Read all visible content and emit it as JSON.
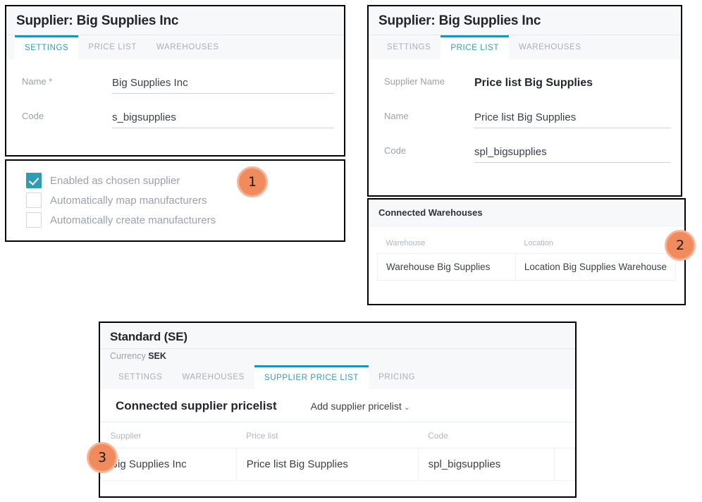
{
  "panel_supplier_settings": {
    "title": "Supplier: Big Supplies Inc",
    "tabs": [
      {
        "label": "SETTINGS",
        "active": true
      },
      {
        "label": "PRICE LIST",
        "active": false
      },
      {
        "label": "WAREHOUSES",
        "active": false
      }
    ],
    "fields": [
      {
        "label": "Name *",
        "value": "Big Supplies Inc"
      },
      {
        "label": "Code",
        "value": "s_bigsupplies"
      }
    ]
  },
  "panel_supplier_checkboxes": {
    "items": [
      {
        "label": "Enabled as chosen supplier",
        "checked": true
      },
      {
        "label": "Automatically map manufacturers",
        "checked": false
      },
      {
        "label": "Automatically create manufacturers",
        "checked": false
      }
    ]
  },
  "panel_price_list": {
    "title": "Supplier: Big Supplies Inc",
    "tabs": [
      {
        "label": "SETTINGS",
        "active": false
      },
      {
        "label": "PRICE LIST",
        "active": true
      },
      {
        "label": "WAREHOUSES",
        "active": false
      }
    ],
    "fields": [
      {
        "label": "Supplier Name",
        "value": "Price list Big Supplies"
      },
      {
        "label": "Name",
        "value": "Price list Big Supplies"
      },
      {
        "label": "Code",
        "value": "spl_bigsupplies"
      }
    ]
  },
  "panel_connected_warehouses": {
    "section_title": "Connected Warehouses",
    "columns": [
      "Warehouse",
      "Location"
    ],
    "rows": [
      [
        "Warehouse Big Supplies",
        "Location Big Supplies Warehouse"
      ]
    ]
  },
  "panel_standard": {
    "title": "Standard (SE)",
    "currency_label": "Currency",
    "currency_value": "SEK",
    "tabs": [
      {
        "label": "SETTINGS",
        "active": false
      },
      {
        "label": "WAREHOUSES",
        "active": false
      },
      {
        "label": "SUPPLIER PRICE LIST",
        "active": true
      },
      {
        "label": "PRICING",
        "active": false
      }
    ],
    "connected_title": "Connected supplier pricelist",
    "add_action": "Add supplier pricelist",
    "add_action_caret": "⌄",
    "columns": [
      "Supplier",
      "Price list",
      "Code",
      ""
    ],
    "rows": [
      [
        "Big Supplies Inc",
        "Price list Big Supplies",
        "spl_bigsupplies",
        ""
      ]
    ]
  },
  "callouts": [
    {
      "number": "1"
    },
    {
      "number": "2"
    },
    {
      "number": "3"
    }
  ],
  "colors": {
    "accent_teal": "#2e9cb5",
    "callout_fill": "#f08b5d",
    "callout_ring": "#f7b394"
  }
}
